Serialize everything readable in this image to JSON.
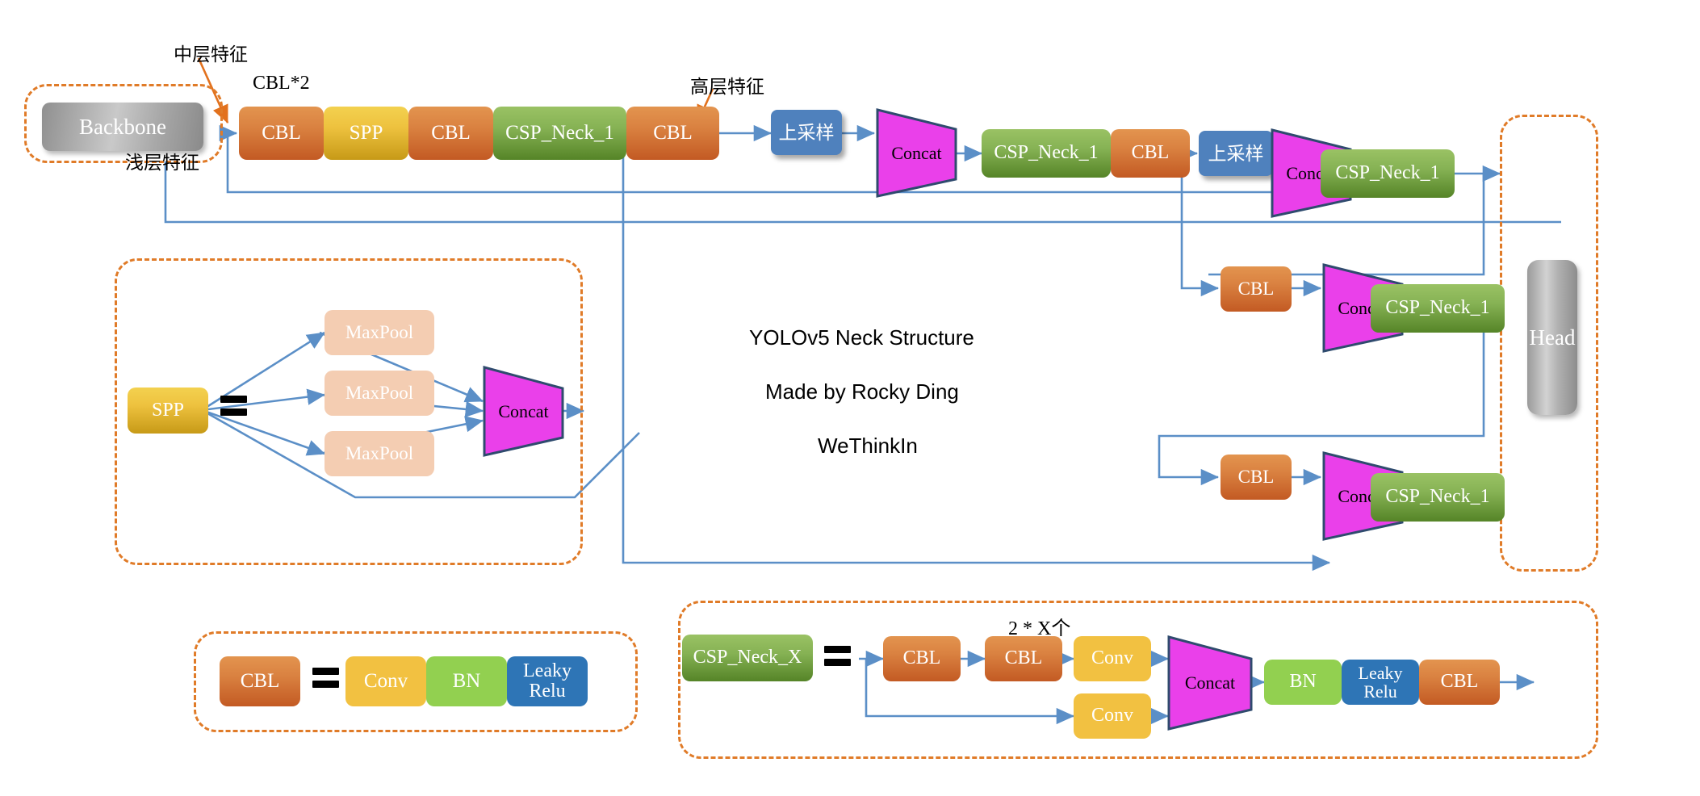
{
  "meta": {
    "title_lines": [
      "YOLOv5 Neck Structure",
      "Made by Rocky Ding",
      "WeThinkIn"
    ]
  },
  "colors": {
    "cbl": "#d2732f",
    "spp": "#e0b52f",
    "csp": "#7ba css",
    "csp_green": "#7aa94e",
    "concat": "#ea40ea",
    "upsample": "#4f81bd",
    "maxpool": "#f4cdb2",
    "conv": "#f2c141",
    "bn": "#92d050",
    "relu": "#2e75b6",
    "dashed_border": "#e07b28",
    "wire": "#5b8fc7",
    "arrow_orange": "#e2711d",
    "backbone": "#a9a9a9",
    "head": "#a9a9a9"
  },
  "annotations": {
    "mid_feature": "中层特征",
    "shallow_feature": "浅层特征",
    "high_feature": "高层特征",
    "cbl_times_2": "CBL*2",
    "two_times_x": "2 * X个"
  },
  "backbone_group": {
    "backbone_label": "Backbone"
  },
  "head_group": {
    "head_label": "Head"
  },
  "main_row": {
    "blocks": [
      {
        "label": "CBL",
        "kind": "cbl"
      },
      {
        "label": "SPP",
        "kind": "spp"
      },
      {
        "label": "CBL",
        "kind": "cbl"
      },
      {
        "label": "CSP_Neck_1",
        "kind": "csp"
      },
      {
        "label": "CBL",
        "kind": "cbl"
      }
    ]
  },
  "fpn": {
    "upsample_1": "上采样",
    "concat_1": "Concat",
    "csp_1": "CSP_Neck_1",
    "cbl_1": "CBL",
    "upsample_2": "上采样",
    "concat_2": "Concat",
    "csp_2": "CSP_Neck_1"
  },
  "pan": {
    "cbl_mid": "CBL",
    "concat_mid": "Concat",
    "csp_mid": "CSP_Neck_1",
    "cbl_bot": "CBL",
    "concat_bot": "Concat",
    "csp_bot": "CSP_Neck_1"
  },
  "spp_legend": {
    "source": "SPP",
    "equals": "=",
    "maxpool": [
      "MaxPool",
      "MaxPool",
      "MaxPool"
    ],
    "concat": "Concat"
  },
  "cbl_legend": {
    "source": "CBL",
    "equals": "=",
    "parts": [
      "Conv",
      "BN",
      "Leaky Relu"
    ]
  },
  "csp_legend": {
    "source": "CSP_Neck_X",
    "equals": "=",
    "top_chain": [
      "CBL",
      "CBL",
      "Conv"
    ],
    "bottom_branch": "Conv",
    "concat": "Concat",
    "tail": [
      "BN",
      "Leaky Relu",
      "CBL"
    ],
    "note": "2 * X个"
  }
}
